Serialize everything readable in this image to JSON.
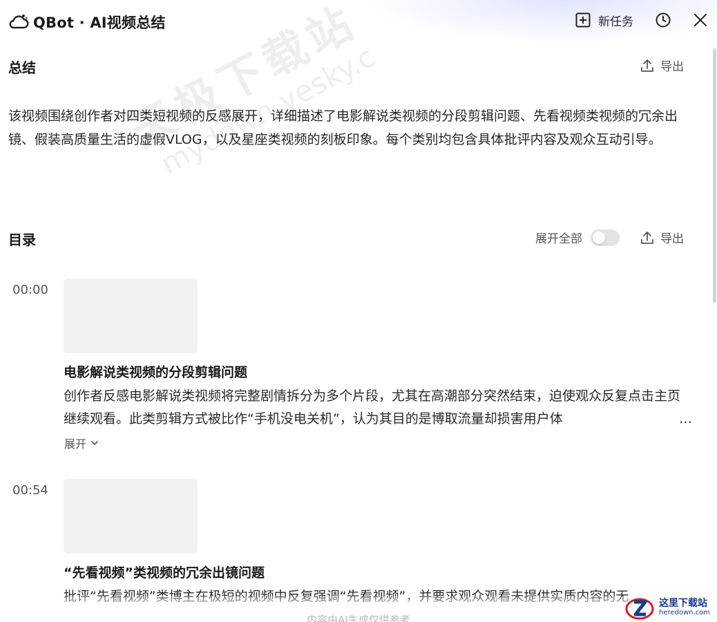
{
  "app": {
    "title": "QBot · AI视频总结"
  },
  "toolbar": {
    "new_task_label": "新任务",
    "icons": {
      "new_task": "plus-square-icon",
      "history": "clock-icon",
      "close": "close-icon"
    }
  },
  "summary": {
    "title": "总结",
    "export_label": "导出",
    "text": "该视频围绕创作者对四类短视频的反感展开，详细描述了电影解说类视频的分段剪辑问题、先看视频类视频的冗余出镜、假装高质量生活的虚假VLOG，以及星座类视频的刻板印象。每个类别均包含具体批评内容及观众互动引导。"
  },
  "toc": {
    "title": "目录",
    "expand_all_label": "展开全部",
    "expand_all_on": false,
    "export_label": "导出",
    "chapters": [
      {
        "time": "00:00",
        "title": "电影解说类视频的分段剪辑问题",
        "desc": "创作者反感电影解说类视频将完整剧情拆分为多个片段，尤其在高潮部分突然结束，迫使观众反复点击主页继续观看。此类剪辑方式被比作“手机没电关机”，认为其目的是博取流量却损害用户体",
        "expand_label": "展开"
      },
      {
        "time": "00:54",
        "title": "“先看视频”类视频的冗余出镜问题",
        "desc": "批评“先看视频”类博主在极短的视频中反复强调“先看视频”，并要求观众观看未提供实质内容的无"
      }
    ]
  },
  "footer": {
    "disclaimer": "内容由AI生成仅供参考"
  },
  "watermark": {
    "line1": "天极下载站",
    "line2": "mydown.yesky.c"
  },
  "corner_badge": {
    "line1": "这里下载站",
    "line2": "heredown.com"
  },
  "colors": {
    "accent": "#1e3a8a",
    "thumb": "#f2f2f2",
    "toggle_off": "#e3e3e3"
  }
}
